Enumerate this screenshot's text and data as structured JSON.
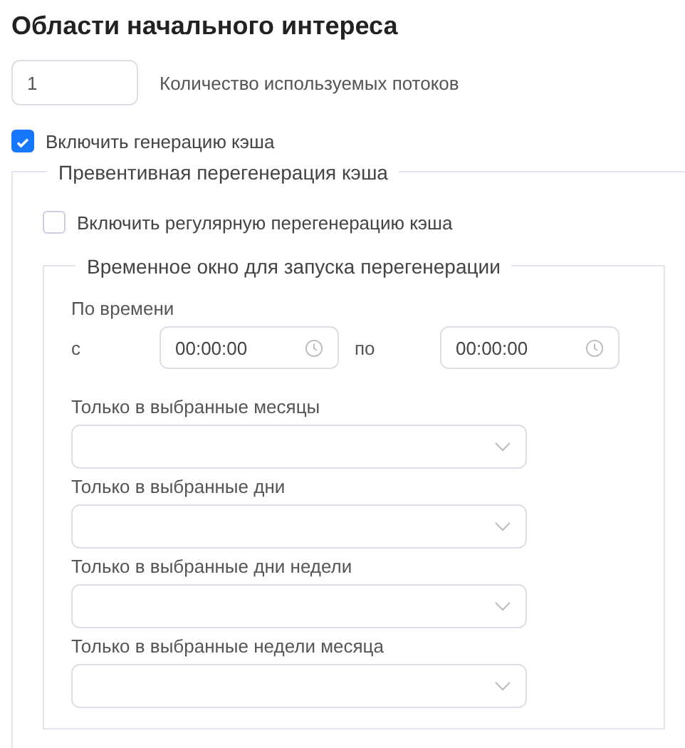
{
  "title": "Области начального интереса",
  "threads": {
    "value": "1",
    "label": "Количество используемых потоков"
  },
  "enable_cache": {
    "label": "Включить генерацию кэша",
    "checked": true
  },
  "preventive": {
    "legend": "Превентивная перегенерация кэша",
    "enable_regular": {
      "label": "Включить регулярную перегенерацию кэша",
      "checked": false
    },
    "window": {
      "legend": "Временное окно для запуска перегенерации",
      "by_time": "По времени",
      "from": {
        "label": "с",
        "value": "00:00:00"
      },
      "to": {
        "label": "по",
        "value": "00:00:00"
      },
      "selects": [
        {
          "label": "Только в выбранные месяцы"
        },
        {
          "label": "Только в выбранные дни"
        },
        {
          "label": "Только в выбранные дни недели"
        },
        {
          "label": "Только в выбранные недели месяца"
        }
      ]
    }
  }
}
